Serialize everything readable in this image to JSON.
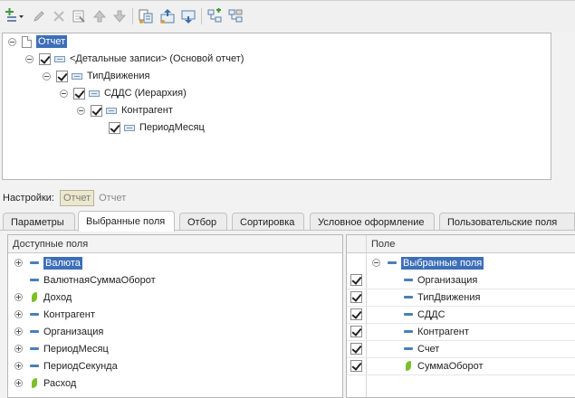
{
  "top_tree": {
    "items": [
      {
        "label": "Отчет"
      },
      {
        "label": "<Детальные записи> (Основой отчет)"
      },
      {
        "label": "ТипДвижения"
      },
      {
        "label": "СДДС (Иерархия)"
      },
      {
        "label": "Контрагент"
      },
      {
        "label": "ПериодМесяц"
      }
    ]
  },
  "settings": {
    "label": "Настройки:",
    "current": "Отчет",
    "alt": "Отчет"
  },
  "tabs": [
    {
      "label": "Параметры"
    },
    {
      "label": "Выбранные поля"
    },
    {
      "label": "Отбор"
    },
    {
      "label": "Сортировка"
    },
    {
      "label": "Условное оформление"
    },
    {
      "label": "Пользовательские поля"
    }
  ],
  "available_fields": {
    "header": "Доступные поля",
    "items": [
      {
        "label": "Валюта",
        "icon": "field-icon"
      },
      {
        "label": "ВалютнаяСуммаОборот",
        "icon": "field-icon"
      },
      {
        "label": "Доход",
        "icon": "resource-leaf-icon"
      },
      {
        "label": "Контрагент",
        "icon": "field-icon"
      },
      {
        "label": "Организация",
        "icon": "field-icon"
      },
      {
        "label": "ПериодМесяц",
        "icon": "field-icon"
      },
      {
        "label": "ПериодСекунда",
        "icon": "field-icon"
      },
      {
        "label": "Расход",
        "icon": "resource-leaf-icon"
      }
    ]
  },
  "selected_fields": {
    "header": "Поле",
    "group": "Выбранные поля",
    "items": [
      {
        "label": "Организация",
        "icon": "field-icon"
      },
      {
        "label": "ТипДвижения",
        "icon": "field-icon"
      },
      {
        "label": "СДДС",
        "icon": "field-icon"
      },
      {
        "label": "Контрагент",
        "icon": "field-icon"
      },
      {
        "label": "Счет",
        "icon": "field-icon"
      },
      {
        "label": "СуммаОборот",
        "icon": "resource-leaf-icon"
      }
    ]
  },
  "colors": {
    "selection": "#3d6fb8",
    "field_icon": "#4a7fb5",
    "resource_icon": "#7bbf2a"
  }
}
